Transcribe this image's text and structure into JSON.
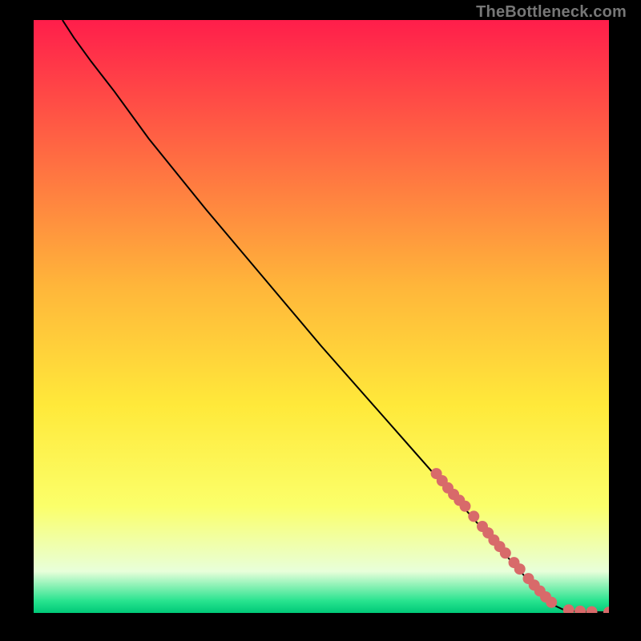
{
  "watermark": "TheBottleneck.com",
  "chart_data": {
    "type": "line",
    "title": "",
    "xlabel": "",
    "ylabel": "",
    "xlim": [
      0,
      100
    ],
    "ylim": [
      0,
      100
    ],
    "grid": false,
    "legend": false,
    "background_gradient": {
      "stops": [
        {
          "pos": 0.0,
          "color": "#ff1e4b"
        },
        {
          "pos": 0.45,
          "color": "#ffb63a"
        },
        {
          "pos": 0.65,
          "color": "#ffe93a"
        },
        {
          "pos": 0.82,
          "color": "#fbff6a"
        },
        {
          "pos": 0.93,
          "color": "#e8ffda"
        },
        {
          "pos": 0.98,
          "color": "#27e38e"
        },
        {
          "pos": 1.0,
          "color": "#00c878"
        }
      ]
    },
    "series": [
      {
        "name": "curve",
        "type": "line",
        "color": "#000000",
        "x": [
          5,
          7,
          10,
          14,
          20,
          30,
          40,
          50,
          60,
          70,
          80,
          86,
          90,
          92,
          94,
          96,
          98,
          100
        ],
        "y": [
          100,
          97,
          93,
          88,
          80,
          68,
          56.5,
          45,
          34,
          23,
          12,
          5.5,
          1.5,
          0.6,
          0.3,
          0.2,
          0.15,
          0.12
        ]
      },
      {
        "name": "highlighted-points",
        "type": "scatter",
        "color": "#d86a6a",
        "x": [
          70,
          71,
          72,
          73,
          74,
          75,
          76.5,
          78,
          79,
          80,
          81,
          82,
          83.5,
          84.5,
          86,
          87,
          88,
          89,
          90,
          93,
          95,
          97,
          100
        ],
        "y": [
          23.5,
          22.3,
          21.1,
          20,
          19,
          18,
          16.3,
          14.6,
          13.5,
          12.3,
          11.2,
          10.1,
          8.5,
          7.4,
          5.8,
          4.7,
          3.7,
          2.7,
          1.8,
          0.5,
          0.3,
          0.2,
          0.12
        ]
      }
    ]
  }
}
